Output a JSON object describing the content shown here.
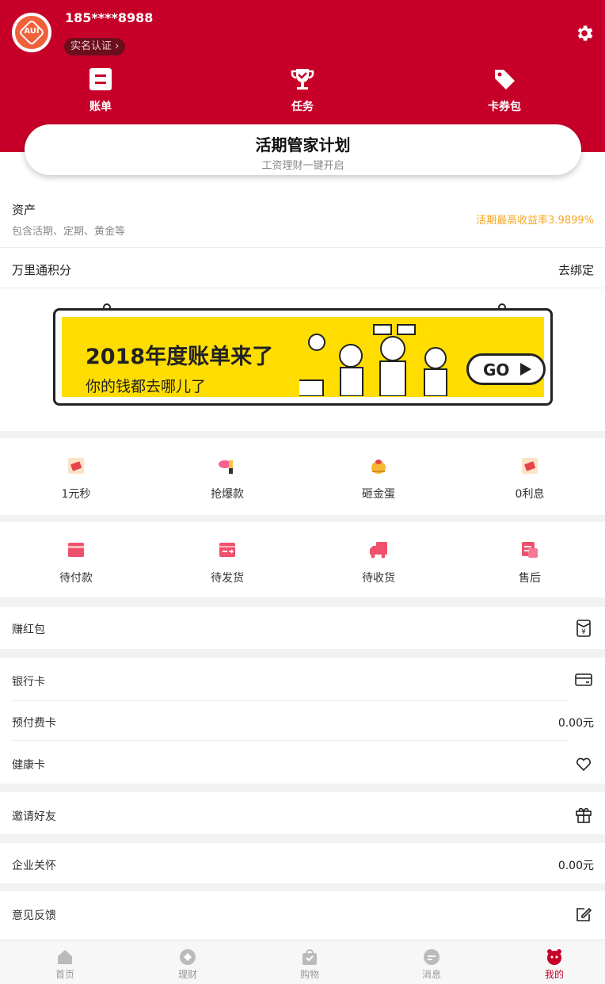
{
  "colors": {
    "brand": "#c7002a",
    "yield": "#f5a623",
    "icon_red": "#f0506e",
    "banner_yellow": "#ffdd00"
  },
  "profile": {
    "phone": "185****8988",
    "verify_label": "实名认证",
    "avatar_logo": "AUI"
  },
  "quick": [
    {
      "label": "账单",
      "icon": "bill-icon"
    },
    {
      "label": "任务",
      "icon": "trophy-icon"
    },
    {
      "label": "卡券包",
      "icon": "tag-icon"
    }
  ],
  "plan": {
    "title": "活期管家计划",
    "subtitle": "工资理财一键开启"
  },
  "assets": {
    "label": "资产",
    "desc": "包含活期、定期、黄金等",
    "yield_text": "活期最高收益率3.9899%"
  },
  "points": {
    "label": "万里通积分",
    "action": "去绑定"
  },
  "banner": {
    "title": "2018年度账单来了",
    "subtitle": "你的钱都去哪儿了",
    "go": "GO"
  },
  "promos": [
    {
      "label": "1元秒",
      "icon": "coupon-icon"
    },
    {
      "label": "抢爆款",
      "icon": "lipstick-icon"
    },
    {
      "label": "砸金蛋",
      "icon": "golden-egg-icon"
    },
    {
      "label": "0利息",
      "icon": "coupon-icon"
    }
  ],
  "orders": [
    {
      "label": "待付款",
      "icon": "wallet-icon"
    },
    {
      "label": "待发货",
      "icon": "package-icon"
    },
    {
      "label": "待收货",
      "icon": "truck-icon"
    },
    {
      "label": "售后",
      "icon": "service-icon"
    }
  ],
  "list": {
    "red_packet": "赚红包",
    "bank_card": "银行卡",
    "prepaid_card": "预付费卡",
    "prepaid_value": "0.00元",
    "health_card": "健康卡",
    "invite": "邀请好友",
    "enterprise": "企业关怀",
    "enterprise_value": "0.00元",
    "feedback": "意见反馈"
  },
  "tabs": [
    {
      "label": "首页",
      "icon": "home-icon"
    },
    {
      "label": "理财",
      "icon": "finance-icon"
    },
    {
      "label": "购物",
      "icon": "shopping-icon"
    },
    {
      "label": "消息",
      "icon": "message-icon"
    },
    {
      "label": "我的",
      "icon": "profile-icon",
      "active": true
    }
  ]
}
